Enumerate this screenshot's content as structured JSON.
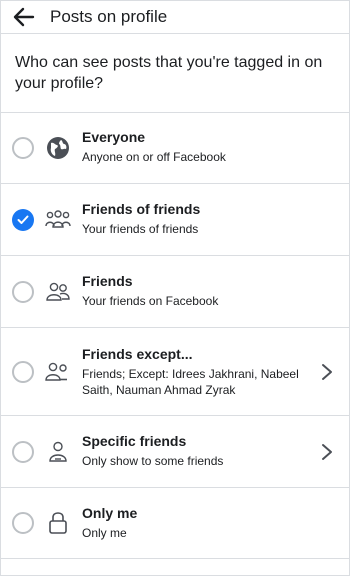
{
  "header": {
    "title": "Posts on profile",
    "back_icon": "back-arrow-icon"
  },
  "question": "Who can see posts that you're tagged in on your profile?",
  "accent_color": "#1877f2",
  "options": [
    {
      "title": "Everyone",
      "subtitle": "Anyone on or off Facebook",
      "icon": "globe-icon",
      "selected": false,
      "has_chevron": false
    },
    {
      "title": "Friends of friends",
      "subtitle": "Your friends of friends",
      "icon": "friends-of-friends-icon",
      "selected": true,
      "has_chevron": false
    },
    {
      "title": "Friends",
      "subtitle": "Your friends on Facebook",
      "icon": "friends-icon",
      "selected": false,
      "has_chevron": false
    },
    {
      "title": "Friends except...",
      "subtitle": "Friends; Except: Idrees Jakhrani, Nabeel Saith, Nauman Ahmad Zyrak",
      "icon": "friends-except-icon",
      "selected": false,
      "has_chevron": true
    },
    {
      "title": "Specific friends",
      "subtitle": "Only show to some friends",
      "icon": "specific-friend-icon",
      "selected": false,
      "has_chevron": true
    },
    {
      "title": "Only me",
      "subtitle": "Only me",
      "icon": "lock-icon",
      "selected": false,
      "has_chevron": false
    }
  ]
}
